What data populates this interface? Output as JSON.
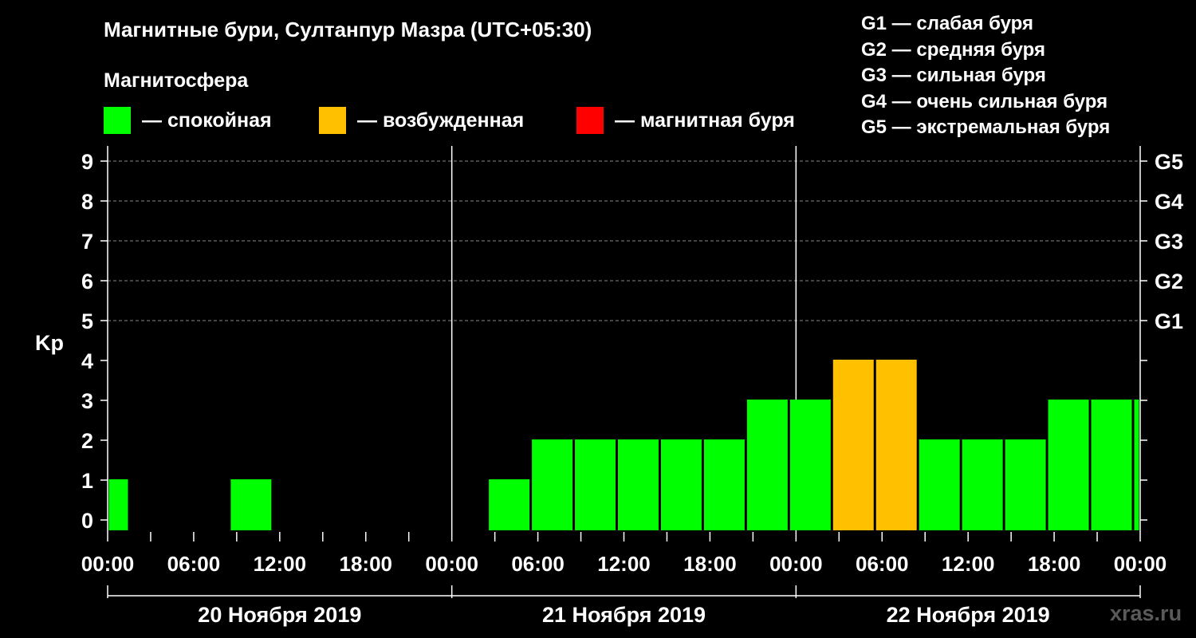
{
  "title": "Магнитные бури, Султанпур Мазра (UTC+05:30)",
  "subtitle": "Магнитосфера",
  "legend": [
    {
      "color": "#00ff00",
      "label": "— спокойная"
    },
    {
      "color": "#ffc000",
      "label": "— возбужденная"
    },
    {
      "color": "#ff0000",
      "label": "— магнитная буря"
    }
  ],
  "g_levels": [
    "G1 — слабая буря",
    "G2 — средняя буря",
    "G3 — сильная буря",
    "G4 — очень сильная буря",
    "G5 — экстремальная буря"
  ],
  "watermark": "xras.ru",
  "chart_data": {
    "type": "bar",
    "ylabel": "Kp",
    "ylim": [
      0,
      9
    ],
    "yticks": [
      0,
      1,
      2,
      3,
      4,
      5,
      6,
      7,
      8,
      9
    ],
    "right_axis_labels": [
      {
        "kp": 5,
        "label": "G1"
      },
      {
        "kp": 6,
        "label": "G2"
      },
      {
        "kp": 7,
        "label": "G3"
      },
      {
        "kp": 8,
        "label": "G4"
      },
      {
        "kp": 9,
        "label": "G5"
      }
    ],
    "x_tick_labels": [
      "00:00",
      "06:00",
      "12:00",
      "18:00",
      "00:00",
      "06:00",
      "12:00",
      "18:00",
      "00:00",
      "06:00",
      "12:00",
      "18:00",
      "00:00"
    ],
    "days": [
      "20 Ноября 2019",
      "21 Ноября 2019",
      "22 Ноября 2019"
    ],
    "grid": "dashed horizontal lines at Kp 5-9",
    "interval_hours": 3,
    "bars": [
      {
        "start": "2019-11-20 00:00",
        "end": "2019-11-20 01:30",
        "kp": 1,
        "level": "спокойная"
      },
      {
        "start": "2019-11-20 08:30",
        "end": "2019-11-20 11:30",
        "kp": 1,
        "level": "спокойная"
      },
      {
        "start": "2019-11-21 02:30",
        "end": "2019-11-21 05:30",
        "kp": 1,
        "level": "спокойная"
      },
      {
        "start": "2019-11-21 05:30",
        "end": "2019-11-21 08:30",
        "kp": 2,
        "level": "спокойная"
      },
      {
        "start": "2019-11-21 08:30",
        "end": "2019-11-21 11:30",
        "kp": 2,
        "level": "спокойная"
      },
      {
        "start": "2019-11-21 11:30",
        "end": "2019-11-21 14:30",
        "kp": 2,
        "level": "спокойная"
      },
      {
        "start": "2019-11-21 14:30",
        "end": "2019-11-21 17:30",
        "kp": 2,
        "level": "спокойная"
      },
      {
        "start": "2019-11-21 17:30",
        "end": "2019-11-21 20:30",
        "kp": 2,
        "level": "спокойная"
      },
      {
        "start": "2019-11-21 20:30",
        "end": "2019-11-21 23:30",
        "kp": 3,
        "level": "спокойная"
      },
      {
        "start": "2019-11-21 23:30",
        "end": "2019-11-22 02:30",
        "kp": 3,
        "level": "спокойная"
      },
      {
        "start": "2019-11-22 02:30",
        "end": "2019-11-22 05:30",
        "kp": 4,
        "level": "возбужденная"
      },
      {
        "start": "2019-11-22 05:30",
        "end": "2019-11-22 08:30",
        "kp": 4,
        "level": "возбужденная"
      },
      {
        "start": "2019-11-22 08:30",
        "end": "2019-11-22 11:30",
        "kp": 2,
        "level": "спокойная"
      },
      {
        "start": "2019-11-22 11:30",
        "end": "2019-11-22 14:30",
        "kp": 2,
        "level": "спокойная"
      },
      {
        "start": "2019-11-22 14:30",
        "end": "2019-11-22 17:30",
        "kp": 2,
        "level": "спокойная"
      },
      {
        "start": "2019-11-22 17:30",
        "end": "2019-11-22 20:30",
        "kp": 3,
        "level": "спокойная"
      },
      {
        "start": "2019-11-22 20:30",
        "end": "2019-11-22 23:30",
        "kp": 3,
        "level": "спокойная"
      },
      {
        "start": "2019-11-22 23:30",
        "end": "2019-11-23 00:00",
        "kp": 3,
        "level": "спокойная"
      }
    ]
  }
}
